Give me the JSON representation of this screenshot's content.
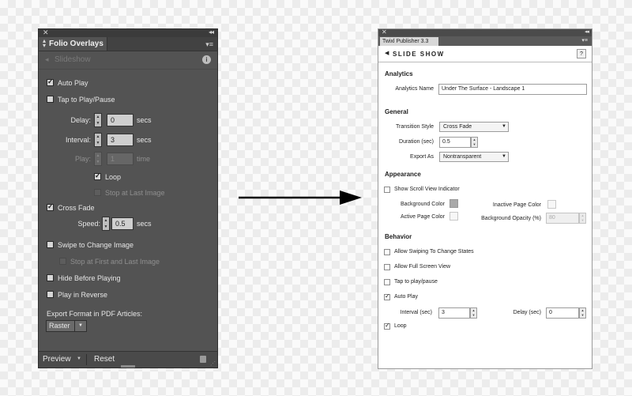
{
  "left_panel": {
    "header": {
      "close": "✕",
      "collapse": "◂◂",
      "tab_title": "Folio Overlays",
      "menu": "▾≡"
    },
    "subheader": {
      "title": "Slideshow",
      "info": "i"
    },
    "auto_play": {
      "label": "Auto Play",
      "checked": true
    },
    "tap_to_play": {
      "label": "Tap to Play/Pause",
      "checked": false
    },
    "delay": {
      "label": "Delay:",
      "value": "0",
      "unit": "secs"
    },
    "interval": {
      "label": "Interval:",
      "value": "3",
      "unit": "secs"
    },
    "play": {
      "label": "Play:",
      "value": "1",
      "unit": "time"
    },
    "loop": {
      "label": "Loop",
      "checked": true
    },
    "stop_at_last": {
      "label": "Stop at Last Image",
      "checked": false
    },
    "cross_fade": {
      "label": "Cross Fade",
      "checked": true
    },
    "speed": {
      "label": "Speed:",
      "value": "0.5",
      "unit": "secs"
    },
    "swipe": {
      "label": "Swipe to Change Image",
      "checked": false
    },
    "stop_first_last": {
      "label": "Stop at First and Last Image",
      "checked": false
    },
    "hide_before": {
      "label": "Hide Before Playing",
      "checked": false
    },
    "play_reverse": {
      "label": "Play in Reverse",
      "checked": false
    },
    "export_format": {
      "label": "Export Format in PDF Articles:",
      "value": "Raster"
    },
    "footer": {
      "preview": "Preview",
      "reset": "Reset"
    }
  },
  "right_panel": {
    "header": {
      "close": "✕",
      "collapse": "◂◂",
      "tab_title": "Twixl Publisher 3.3",
      "menu": "▾≡"
    },
    "title_bar": {
      "title": "SLIDE SHOW",
      "help": "?"
    },
    "analytics": {
      "section": "Analytics",
      "name_label": "Analytics Name",
      "name_value": "Under The Surface - Landscape 1"
    },
    "general": {
      "section": "General",
      "transition_label": "Transition Style",
      "transition_value": "Cross Fade",
      "duration_label": "Duration (sec)",
      "duration_value": "0.5",
      "export_label": "Export As",
      "export_value": "Nontransparent"
    },
    "appearance": {
      "section": "Appearance",
      "scroll_label": "Show Scroll View Indicator",
      "scroll_checked": false,
      "bg_color_label": "Background Color",
      "inactive_label": "Inactive Page Color",
      "active_label": "Active Page Color",
      "opacity_label": "Background Opacity (%)",
      "opacity_value": "80"
    },
    "behavior": {
      "section": "Behavior",
      "swipe_label": "Allow Swiping To Change States",
      "swipe_checked": false,
      "fullscreen_label": "Allow Full Screen View",
      "fullscreen_checked": false,
      "tap_label": "Tap to play/pause",
      "tap_checked": false,
      "autoplay_label": "Auto Play",
      "autoplay_checked": true,
      "interval_label": "Interval (sec)",
      "interval_value": "3",
      "delay_label": "Delay (sec)",
      "delay_value": "0",
      "loop_label": "Loop",
      "loop_checked": true
    }
  }
}
